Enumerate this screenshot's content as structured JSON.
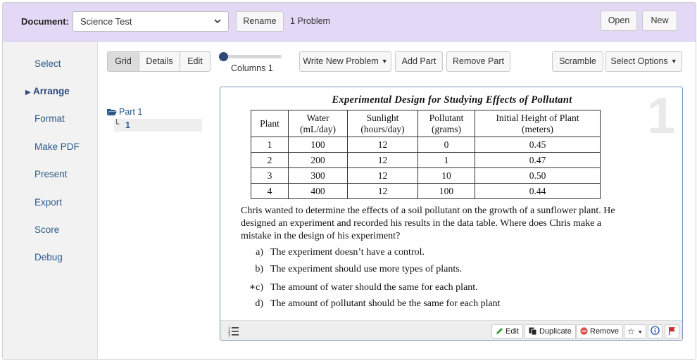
{
  "header": {
    "document_label": "Document:",
    "document_value": "Science Test",
    "rename_label": "Rename",
    "problem_count": "1 Problem",
    "open_label": "Open",
    "new_label": "New"
  },
  "sidebar": {
    "items": [
      {
        "label": "Select"
      },
      {
        "label": "Arrange",
        "marker": "▶"
      },
      {
        "label": "Format"
      },
      {
        "label": "Make PDF"
      },
      {
        "label": "Present"
      },
      {
        "label": "Export"
      },
      {
        "label": "Score"
      },
      {
        "label": "Debug"
      }
    ]
  },
  "toolbar": {
    "view_tabs": [
      "Grid",
      "Details",
      "Edit"
    ],
    "active_view": "Grid",
    "columns_label": "Columns 1",
    "write_new_problem": "Write New Problem",
    "add_part": "Add Part",
    "remove_part": "Remove Part",
    "scramble": "Scramble",
    "select_options": "Select Options"
  },
  "tree": {
    "part_label": "Part 1",
    "child_label": "1"
  },
  "problem": {
    "number": "1",
    "title": "Experimental Design for Studying Effects of Pollutant",
    "table": {
      "headers": [
        [
          "Plant"
        ],
        [
          "Water",
          "(mL/day)"
        ],
        [
          "Sunlight",
          "(hours/day)"
        ],
        [
          "Pollutant",
          "(grams)"
        ],
        [
          "Initial Height of Plant",
          "(meters)"
        ]
      ],
      "rows": [
        [
          "1",
          "100",
          "12",
          "0",
          "0.45"
        ],
        [
          "2",
          "200",
          "12",
          "1",
          "0.47"
        ],
        [
          "3",
          "300",
          "12",
          "10",
          "0.50"
        ],
        [
          "4",
          "400",
          "12",
          "100",
          "0.44"
        ]
      ]
    },
    "stem": "Chris wanted to determine the effects of a soil pollutant on the growth of a sunflower plant. He designed an experiment and recorded his results in the data table. Where does Chris make a mistake in the design of his experiment?",
    "choices": [
      {
        "label": "a)",
        "text": "The experiment doesn’t have a control."
      },
      {
        "label": "b)",
        "text": "The experiment should use more types of plants."
      },
      {
        "label": "∗c)",
        "text": "The amount of water should the same for each plant."
      },
      {
        "label": "d)",
        "text": "The amount of pollutant should be the same for each plant"
      }
    ],
    "footer": {
      "edit": "Edit",
      "duplicate": "Duplicate",
      "remove": "Remove"
    }
  },
  "colors": {
    "header_bg": "#e3d9f7",
    "sidebar_link": "#2d5a8c",
    "card_border": "#7e96b8"
  }
}
